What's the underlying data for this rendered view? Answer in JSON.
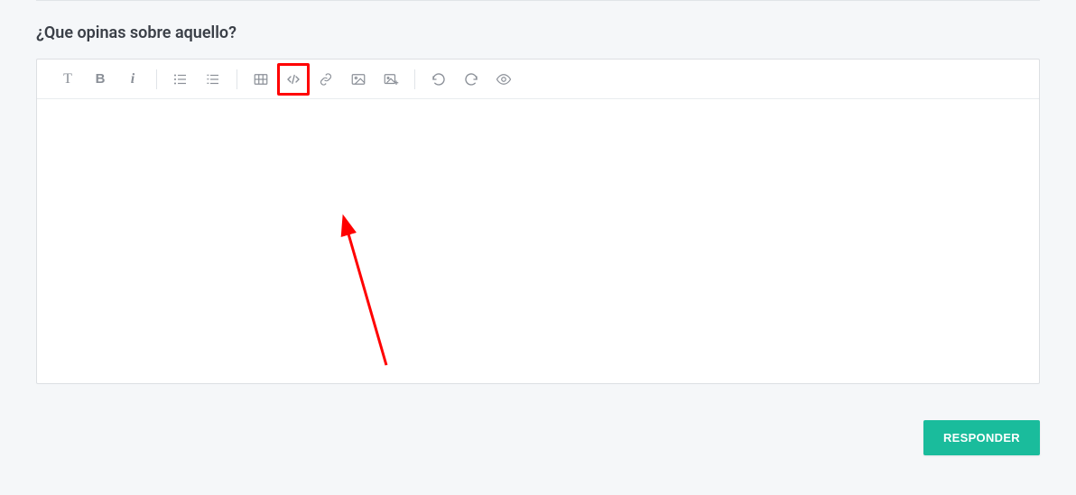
{
  "question": {
    "title": "¿Que opinas sobre aquello?"
  },
  "toolbar": {
    "text_label": "T",
    "bold_label": "B",
    "italic_label": "i"
  },
  "actions": {
    "submit_label": "RESPONDER"
  }
}
